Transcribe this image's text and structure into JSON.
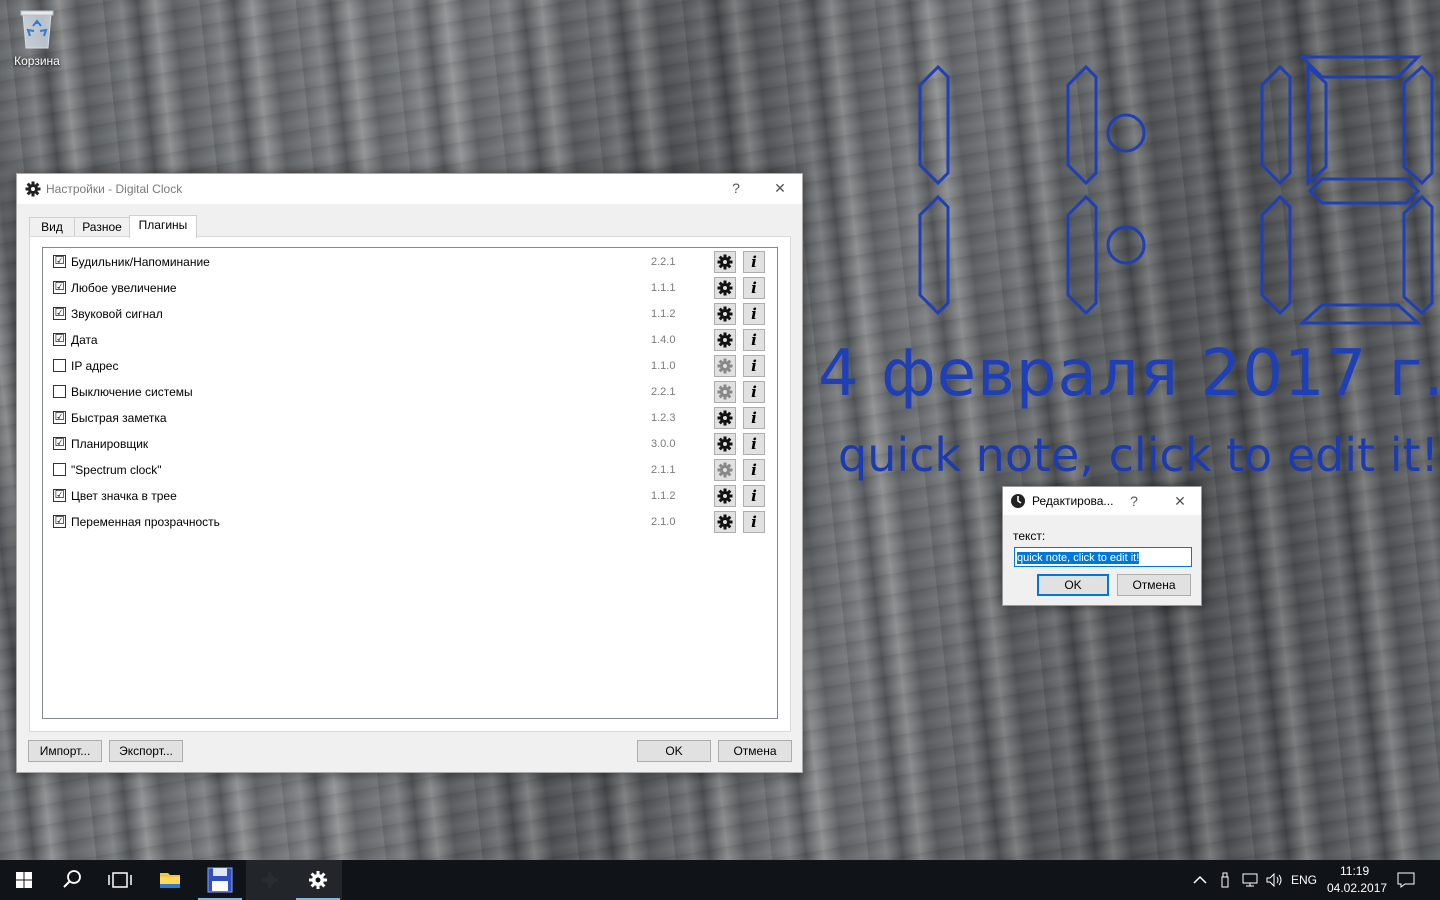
{
  "desktop": {
    "recycle_bin_label": "Корзина"
  },
  "clock_widget": {
    "time": "11:19",
    "date": "4 февраля 2017 г.",
    "note": "quick note, click to edit it!",
    "color": "#1e3fb5"
  },
  "settings_window": {
    "title": "Настройки - Digital Clock",
    "help": "?",
    "close": "✕",
    "tabs": [
      "Вид",
      "Разное",
      "Плагины"
    ],
    "active_tab": "Плагины",
    "plugins": [
      {
        "name": "Будильник/Напоминание",
        "version": "2.2.1",
        "checked": "☑",
        "enabled": true
      },
      {
        "name": "Любое увеличение",
        "version": "1.1.1",
        "checked": "☑",
        "enabled": true
      },
      {
        "name": "Звуковой сигнал",
        "version": "1.1.2",
        "checked": "☑",
        "enabled": true
      },
      {
        "name": "Дата",
        "version": "1.4.0",
        "checked": "☑",
        "enabled": true
      },
      {
        "name": "IP адрес",
        "version": "1.1.0",
        "checked": "",
        "enabled": false
      },
      {
        "name": "Выключение системы",
        "version": "2.2.1",
        "checked": "",
        "enabled": false
      },
      {
        "name": "Быстрая заметка",
        "version": "1.2.3",
        "checked": "☑",
        "enabled": true
      },
      {
        "name": "Планировщик",
        "version": "3.0.0",
        "checked": "☑",
        "enabled": true
      },
      {
        "name": "\"Spectrum clock\"",
        "version": "2.1.1",
        "checked": "",
        "enabled": false
      },
      {
        "name": "Цвет значка в трее",
        "version": "1.1.2",
        "checked": "☑",
        "enabled": true
      },
      {
        "name": "Переменная прозрачность",
        "version": "2.1.0",
        "checked": "☑",
        "enabled": true
      }
    ],
    "info_glyph": "i",
    "import_label": "Импорт...",
    "export_label": "Экспорт...",
    "ok_label": "OK",
    "cancel_label": "Отмена"
  },
  "edit_dialog": {
    "title": "Редактирова...",
    "help": "?",
    "close": "✕",
    "field_label": "текст:",
    "field_value": "quick note, click to edit it!",
    "ok_label": "OK",
    "cancel_label": "Отмена"
  },
  "taskbar": {
    "language": "ENG",
    "time": "11:19",
    "date": "04.02.2017",
    "accent": "#76b9ed"
  }
}
